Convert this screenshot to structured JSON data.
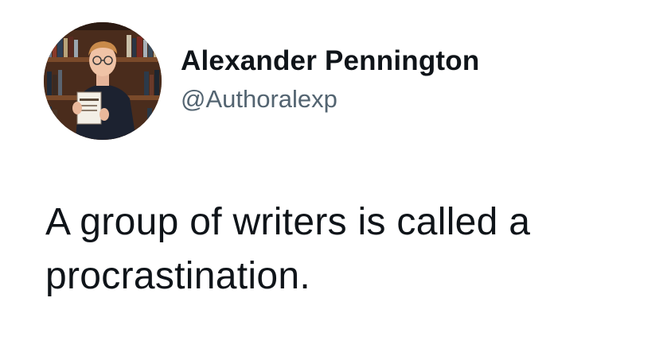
{
  "author": {
    "display_name": "Alexander Pennington",
    "handle": "@Authoralexp",
    "avatar": "profile-photo-man-holding-book-bookshelf"
  },
  "tweet": {
    "text": "A group of writers is called a procrastination."
  },
  "colors": {
    "background": "#ffffff",
    "text": "#0f1419",
    "handle": "#536471"
  }
}
